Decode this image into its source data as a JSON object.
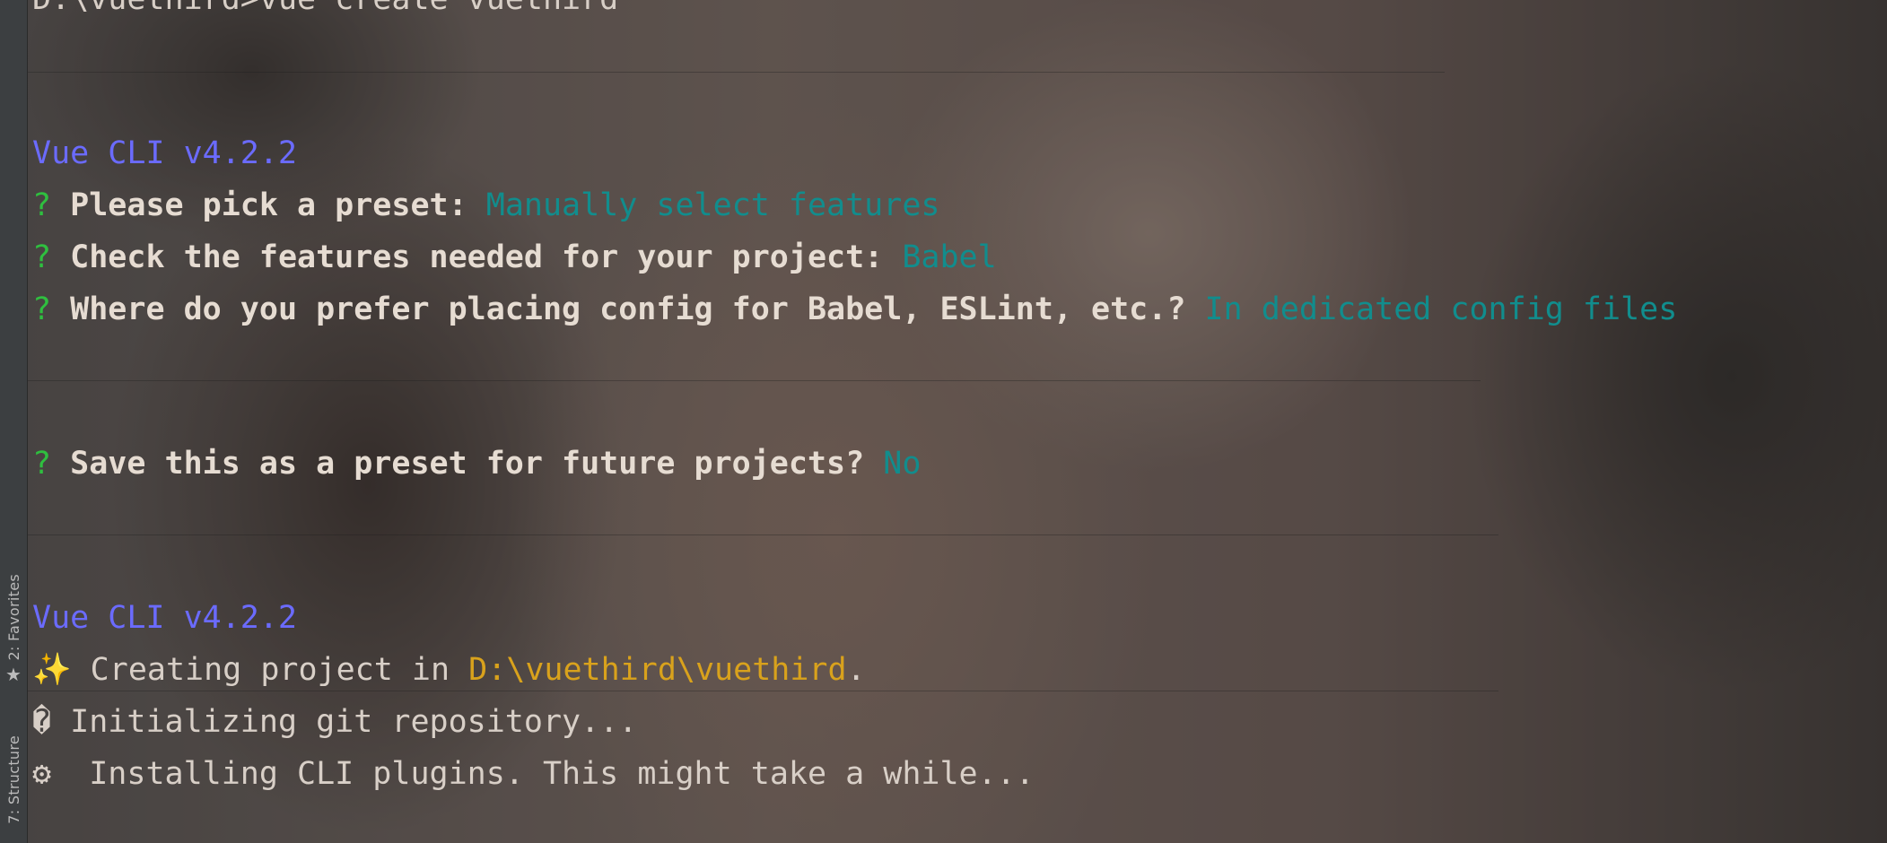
{
  "side_tabs": {
    "favorites": "2: Favorites",
    "structure": "7: Structure",
    "favorites_icon": "star-icon"
  },
  "terminal": {
    "command_prompt": "D:\\vuethird>",
    "command": "vue create vuethird",
    "cli_version_1": "Vue CLI v4.2.2",
    "q1_mark": "?",
    "q1_text": "Please pick a preset:",
    "q1_answer": "Manually select features",
    "q2_mark": "?",
    "q2_text": "Check the features needed for your project:",
    "q2_answer": "Babel",
    "q3_mark": "?",
    "q3_text": "Where do you prefer placing config for Babel, ESLint, etc.?",
    "q3_answer": "In dedicated config files",
    "q4_mark": "?",
    "q4_text": "Save this as a preset for future projects?",
    "q4_answer": "No",
    "cli_version_2": "Vue CLI v4.2.2",
    "creating_icon": "✨",
    "creating_text": "Creating project in",
    "creating_path": "D:\\vuethird\\vuethird",
    "creating_end": ".",
    "git_icon": "�",
    "git_text": "Initializing git repository...",
    "install_icon": "⚙",
    "install_text": "Installing CLI plugins. This might take a while..."
  },
  "colors": {
    "question_mark": "#2fbf3f",
    "answer": "#118d8d",
    "vue_version": "#6b6bff",
    "path": "#d9a21c"
  }
}
